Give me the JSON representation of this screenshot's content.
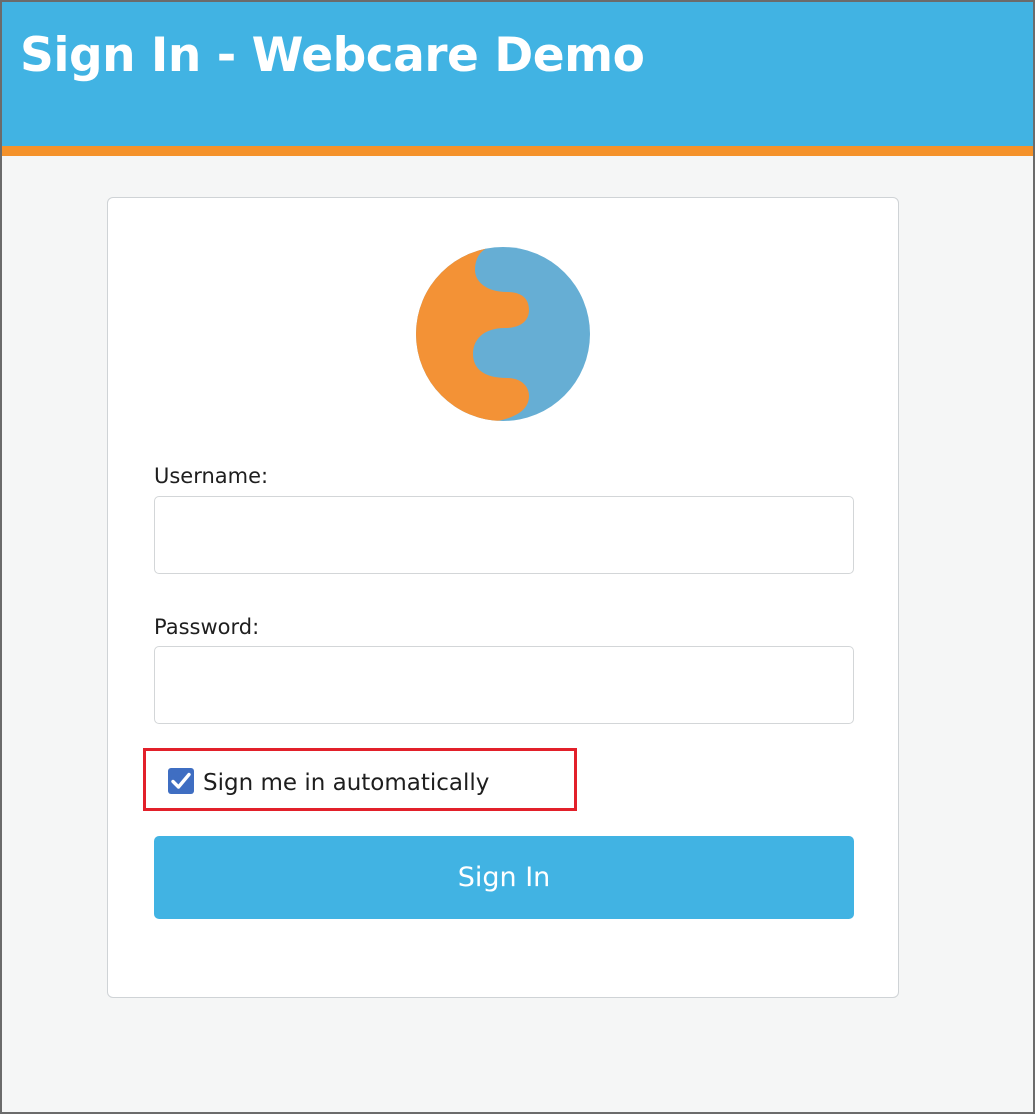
{
  "header": {
    "title": "Sign In - Webcare Demo"
  },
  "form": {
    "username_label": "Username:",
    "username_value": "",
    "password_label": "Password:",
    "password_value": "",
    "remember_label": "Sign me in automatically",
    "remember_checked": true,
    "submit_label": "Sign In"
  },
  "logo": {
    "icon": "webcare-logo-icon"
  },
  "colors": {
    "header_bg": "#41b3e3",
    "header_accent": "#f4922b",
    "logo_orange": "#f39236",
    "logo_blue": "#66aed4",
    "checkbox": "#3f6ec2",
    "highlight": "#e2202a"
  }
}
